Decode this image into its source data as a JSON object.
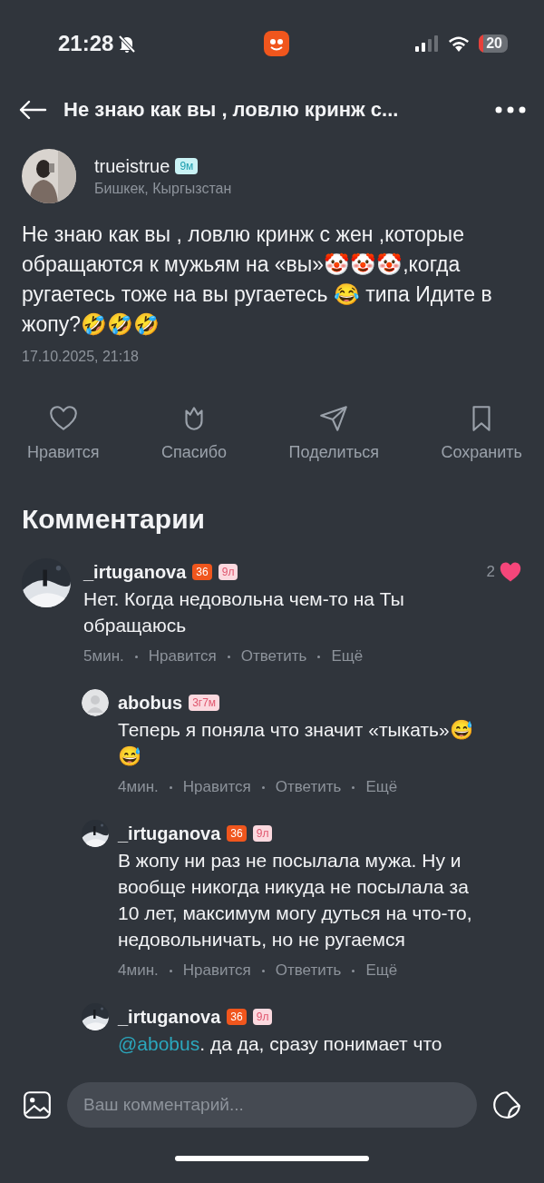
{
  "status_bar": {
    "time": "21:28",
    "battery": "20"
  },
  "header": {
    "title": "Не знаю как вы , ловлю кринж с..."
  },
  "post": {
    "author": "trueistrue",
    "badge": "9м",
    "location": "Бишкек, Кыргызстан",
    "text": "Не знаю как вы , ловлю кринж с жен ,которые обращаются к мужьям  на «вы»🤡🤡🤡,когда ругаетесь тоже на вы ругаетесь 😂 типа Идите в жопу?🤣🤣🤣",
    "date": "17.10.2025, 21:18",
    "actions": [
      {
        "kind": "like",
        "label": "Нравится"
      },
      {
        "kind": "thanks",
        "label": "Спасибо"
      },
      {
        "kind": "share",
        "label": "Поделиться"
      },
      {
        "kind": "save",
        "label": "Сохранить"
      }
    ]
  },
  "comments_title": "Комментарии",
  "comments": [
    {
      "author": "_irtuganova",
      "kind": "picture",
      "badges": [
        {
          "text": "36",
          "color": "#f0561d"
        },
        {
          "text": "9л",
          "color": "#fbd9df"
        }
      ],
      "likes": "2",
      "text": "Нет. Когда недовольна чем-то на Ты обращаюсь",
      "time": "5мин.",
      "like": "Нравится",
      "reply": "Ответить",
      "more": "Ещё",
      "children": [
        {
          "author": "abobus",
          "kind": "silhouette",
          "badges": [
            {
              "text": "3г7м",
              "color": "#fbd9df"
            }
          ],
          "text": "Теперь я поняла что значит «тыкать»😅😅",
          "time": "4мин.",
          "like": "Нравится",
          "reply": "Ответить",
          "more": "Ещё"
        },
        {
          "author": "_irtuganova",
          "kind": "picture",
          "badges": [
            {
              "text": "36",
              "color": "#f0561d"
            },
            {
              "text": "9л",
              "color": "#fbd9df"
            }
          ],
          "text": "В жопу ни раз не посылала мужа. Ну и вообще никогда никуда не посылала за 10 лет, максимум могу дуться на что-то, недовольничать, но не ругаемся",
          "time": "4мин.",
          "like": "Нравится",
          "reply": "Ответить",
          "more": "Ещё"
        },
        {
          "author": "_irtuganova",
          "kind": "picture",
          "badges": [
            {
              "text": "36",
              "color": "#f0561d"
            },
            {
              "text": "9л",
              "color": "#fbd9df"
            }
          ],
          "mention": "@abobus",
          "text": ". да да, сразу понимает что"
        }
      ]
    }
  ],
  "composer": {
    "placeholder": "Ваш комментарий..."
  }
}
